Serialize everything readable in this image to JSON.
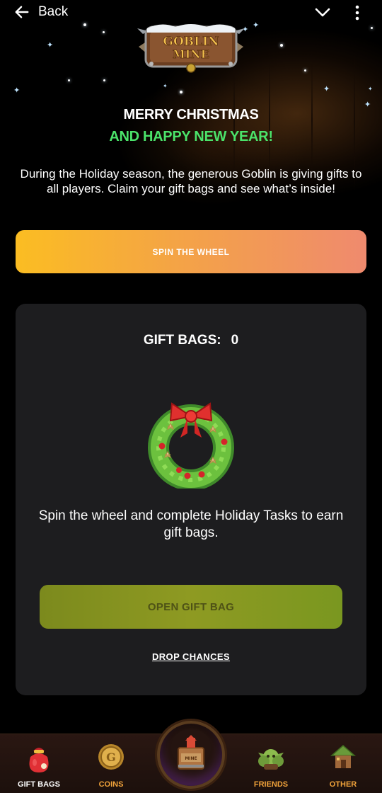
{
  "header": {
    "back_label": "Back"
  },
  "logo": {
    "text_line1": "GOBLIN",
    "text_line2": "MINE"
  },
  "banner": {
    "title_line1": "MERRY CHRISTMAS",
    "title_line2": "AND HAPPY NEW YEAR!",
    "description": "During the Holiday season, the generous Goblin is giving gifts to all players. Claim your gift bags and see what’s inside!"
  },
  "spin_button": {
    "label": "SPIN THE WHEEL"
  },
  "gift_card": {
    "bags_label": "GIFT BAGS:",
    "bags_count": "0",
    "info_text": "Spin the wheel and complete Holiday Tasks to earn gift bags.",
    "open_button_label": "OPEN GIFT BAG",
    "drop_chances_label": "DROP CHANCES"
  },
  "bottom_nav": {
    "items": [
      {
        "label": "GIFT BAGS",
        "icon": "gift-bag-icon",
        "active": true
      },
      {
        "label": "COINS",
        "icon": "coin-icon",
        "active": false
      },
      {
        "label": "FRIENDS",
        "icon": "goblin-friends-icon",
        "active": false
      },
      {
        "label": "OTHER",
        "icon": "hut-icon",
        "active": false
      }
    ],
    "center_icon": "mine-crate-icon"
  },
  "colors": {
    "accent_green": "#4be36a",
    "spin_gradient_start": "#fbbd22",
    "spin_gradient_end": "#ef8a6e",
    "open_button_bg": "#8e9a22",
    "card_bg": "#1d1d1f",
    "nav_label": "#f0a23a"
  }
}
